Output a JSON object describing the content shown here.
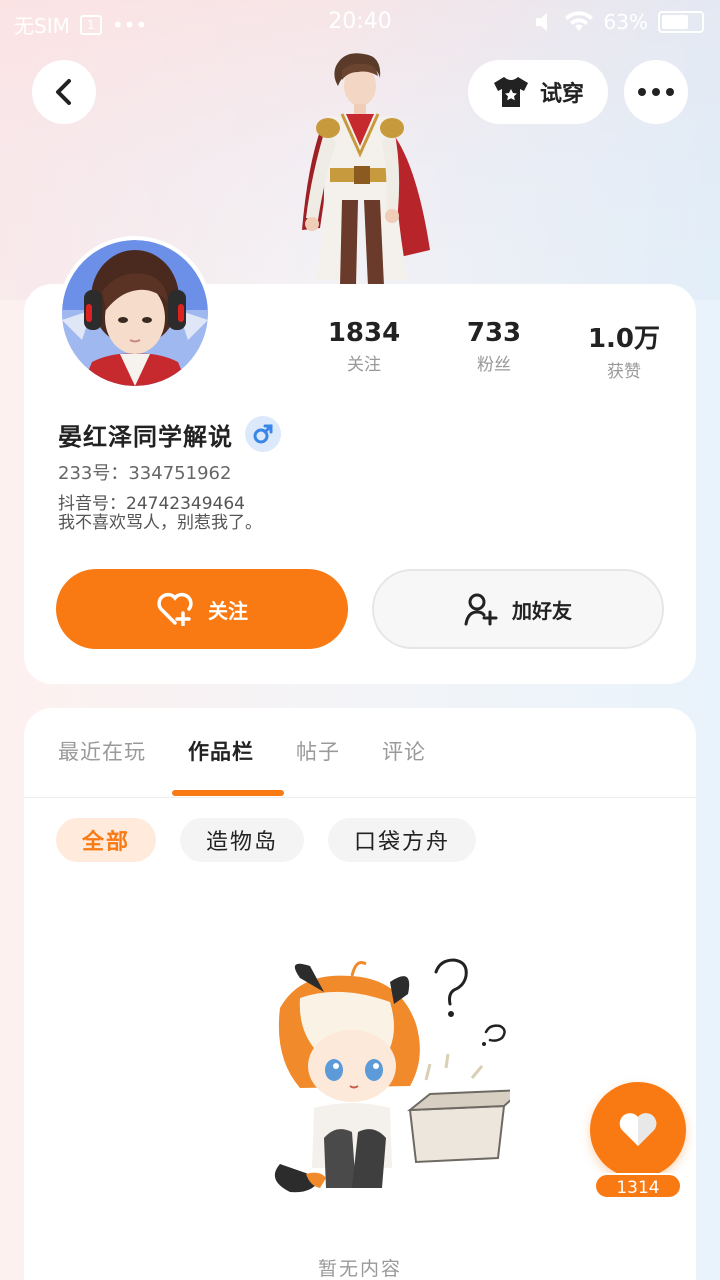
{
  "status_bar": {
    "sim": "无SIM",
    "time": "20:40",
    "battery": "63%"
  },
  "header": {
    "try_on_label": "试穿"
  },
  "profile": {
    "name": "晏红泽同学解说",
    "id_line": "233号：334751962",
    "bio_line1": "抖音号：24742349464",
    "bio_line2": "我不喜欢骂人，别惹我了。",
    "stats": [
      {
        "value": "1834",
        "label": "关注"
      },
      {
        "value": "733",
        "label": "粉丝"
      },
      {
        "value": "1.0万",
        "label": "获赞"
      }
    ],
    "follow_label": "关注",
    "add_friend_label": "加好友"
  },
  "tabs": [
    {
      "label": "最近在玩",
      "active": false
    },
    {
      "label": "作品栏",
      "active": true
    },
    {
      "label": "帖子",
      "active": false
    },
    {
      "label": "评论",
      "active": false
    }
  ],
  "chips": [
    {
      "label": "全部",
      "active": true
    },
    {
      "label": "造物岛",
      "active": false
    },
    {
      "label": "口袋方舟",
      "active": false
    }
  ],
  "empty_text": "暂无内容",
  "like": {
    "count": "1314"
  },
  "colors": {
    "accent": "#f97a13",
    "gender_bg": "#dbe9fb",
    "gender_icon": "#3a86e8"
  }
}
